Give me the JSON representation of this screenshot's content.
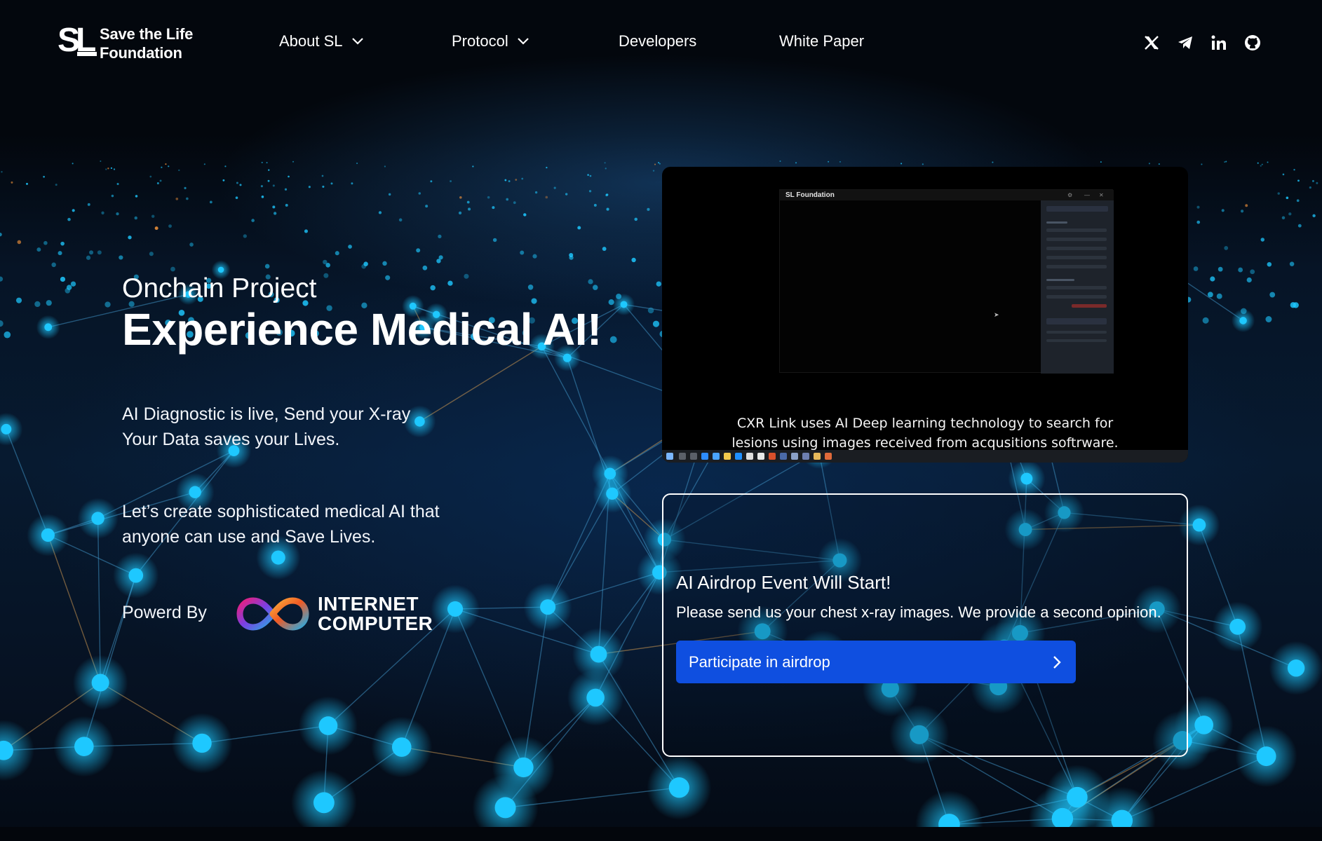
{
  "brand": {
    "mark": "SL",
    "line1": "Save the Life",
    "line2": "Foundation"
  },
  "nav": {
    "items": [
      {
        "label": "About SL",
        "has_dropdown": true
      },
      {
        "label": "Protocol",
        "has_dropdown": true
      },
      {
        "label": "Developers",
        "has_dropdown": false
      },
      {
        "label": "White Paper",
        "has_dropdown": false
      }
    ]
  },
  "social": [
    "x-icon",
    "telegram-icon",
    "linkedin-icon",
    "github-icon"
  ],
  "hero": {
    "subtitle": "Onchain Project",
    "title": "Experience Medical AI!",
    "paragraph1": [
      "AI Diagnostic is live, Send your X-ray",
      "Your Data saves your Lives."
    ],
    "paragraph2": [
      "Let’s create sophisticated medical AI that",
      "anyone can use and Save Lives."
    ],
    "powered_by": "Powerd By",
    "partner": [
      "INTERNET",
      "COMPUTER"
    ]
  },
  "video": {
    "window_title": "SL Foundation",
    "caption": [
      "CXR Link uses AI Deep learning technology to search for",
      "lesions using images received from acqusitions softrware."
    ]
  },
  "airdrop": {
    "title": "AI Airdrop Event Will Start!",
    "description": "Please send us your chest x-ray images. We provide a second opinion.",
    "button_label": "Participate in airdrop"
  },
  "colors": {
    "background": "#03060c",
    "node": "#1ec8ff",
    "accent_button": "#0f4fe0"
  }
}
